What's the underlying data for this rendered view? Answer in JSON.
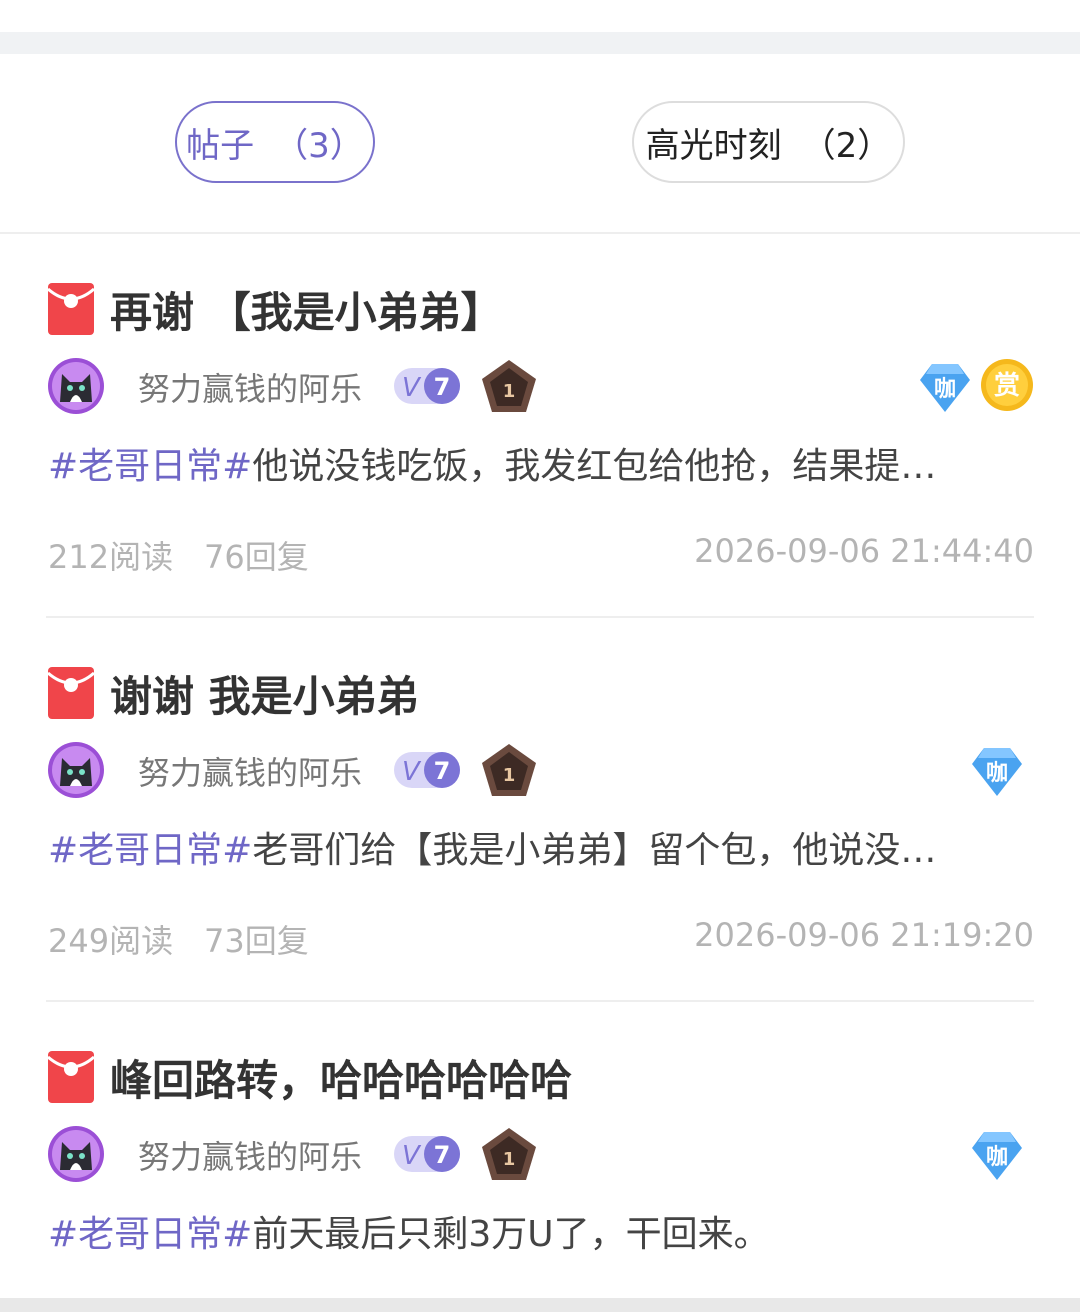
{
  "tabs": [
    {
      "label": "帖子",
      "count": "（3）",
      "active": true
    },
    {
      "label": "高光时刻",
      "count": "（2）",
      "active": false
    }
  ],
  "posts": [
    {
      "title": "再谢 【我是小弟弟】",
      "author": "努力赢钱的阿乐",
      "vip_level": "7",
      "rank_level": "1",
      "badges": [
        "咖",
        "赏"
      ],
      "tag": "#老哥日常#",
      "excerpt": "他说没钱吃饭，我发红包给他抢，结果提…",
      "reads": "212阅读",
      "replies": "76回复",
      "time": "2026-09-06 21:44:40"
    },
    {
      "title": "谢谢 我是小弟弟",
      "author": "努力赢钱的阿乐",
      "vip_level": "7",
      "rank_level": "1",
      "badges": [
        "咖"
      ],
      "tag": "#老哥日常#",
      "excerpt": "老哥们给【我是小弟弟】留个包，他说没…",
      "reads": "249阅读",
      "replies": "73回复",
      "time": "2026-09-06 21:19:20"
    },
    {
      "title": "峰回路转，哈哈哈哈哈哈",
      "author": "努力赢钱的阿乐",
      "vip_level": "7",
      "rank_level": "1",
      "badges": [
        "咖"
      ],
      "tag": "#老哥日常#",
      "excerpt": "前天最后只剩3万U了，干回来。"
    }
  ],
  "icons": {
    "redpacket": "red-packet-icon",
    "vip": "vip-level-badge",
    "rank": "rank-badge",
    "ka": "diamond-ka-badge",
    "shang": "reward-shang-badge"
  },
  "colors": {
    "accent": "#6f67c6",
    "red_packet": "#f0454a",
    "reward_gold": "#f5b81c",
    "diamond_blue": "#4aa3f0",
    "meta_gray": "#b4b4b4"
  }
}
